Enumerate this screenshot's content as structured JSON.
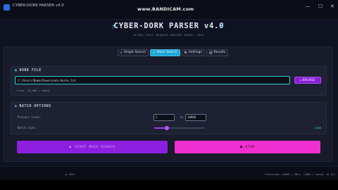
{
  "window": {
    "title": "CYBER-DORK PARSER v4.0",
    "watermark": "www.BANDICAM.com",
    "controls": {
      "minimize": "—",
      "maximize": "☐",
      "close": "✕"
    }
  },
  "header": {
    "title": "CYBER-DORK PARSER v4.0",
    "subtitle": "ULTRA-FAST SEARCH ENGINE QUERY TOOL"
  },
  "tabs": [
    {
      "label": "Single Search",
      "icon": "search-icon",
      "active": false
    },
    {
      "label": "Mass Search",
      "icon": "lightning-icon",
      "active": true
    },
    {
      "label": "Settings",
      "icon": "gear-icon",
      "active": false
    },
    {
      "label": "Results",
      "icon": "results-icon",
      "active": false
    }
  ],
  "dork_file": {
    "section_title": "DORK FILE",
    "path": "C:/Users/Name/Downloads/dorks.txt",
    "browse_label": "BROWSE",
    "status": "Lines: 10,000 | Ready"
  },
  "batch_options": {
    "section_title": "BATCH OPTIONS",
    "process_lines_label": "Process lines:",
    "from_value": "1",
    "to_label": "to",
    "to_value": "10000",
    "batch_size_label": "Batch size:",
    "batch_size_value": "1000",
    "slider_fraction": 0.25
  },
  "actions": {
    "start_label": "START MASS SEARCH",
    "stop_label": "STOP"
  },
  "status": {
    "left": "▶ IDLE",
    "right": "Processed: 10000 | URLs: 12800 | Speed: 16.5/s"
  },
  "colors": {
    "accent_cyan": "#1fa6d6",
    "accent_purple": "#8d1fe0",
    "accent_magenta": "#f02fd0",
    "teal_border": "#30d0c8"
  }
}
